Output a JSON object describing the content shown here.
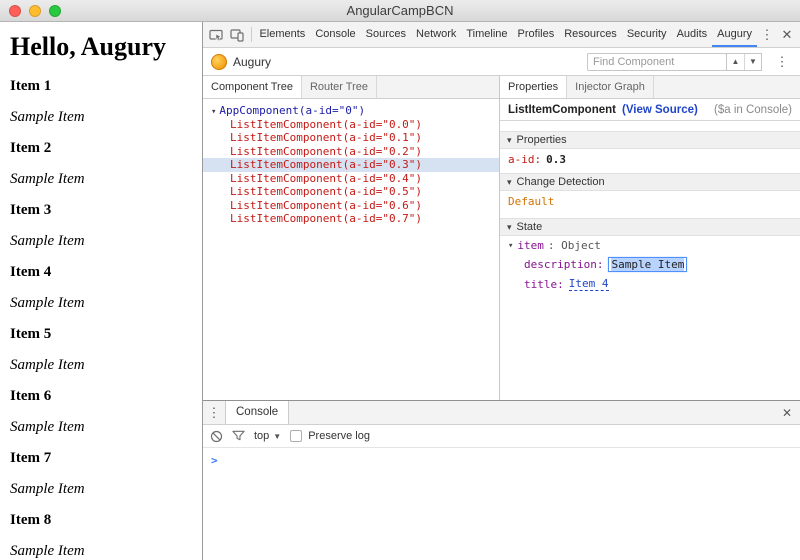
{
  "window": {
    "title": "AngularCampBCN"
  },
  "page": {
    "heading": "Hello, Augury",
    "items": [
      {
        "title": "Item 1",
        "description": "Sample Item"
      },
      {
        "title": "Item 2",
        "description": "Sample Item"
      },
      {
        "title": "Item 3",
        "description": "Sample Item"
      },
      {
        "title": "Item 4",
        "description": "Sample Item"
      },
      {
        "title": "Item 5",
        "description": "Sample Item"
      },
      {
        "title": "Item 6",
        "description": "Sample Item"
      },
      {
        "title": "Item 7",
        "description": "Sample Item"
      },
      {
        "title": "Item 8",
        "description": "Sample Item"
      }
    ]
  },
  "devtools": {
    "tabs": {
      "items": [
        "Elements",
        "Console",
        "Sources",
        "Network",
        "Timeline",
        "Profiles",
        "Resources",
        "Security",
        "Audits",
        "Augury"
      ],
      "selected": "Augury"
    },
    "augury": {
      "label": "Augury",
      "search_placeholder": "Find Component"
    },
    "tree_pane": {
      "tabs": [
        "Component Tree",
        "Router Tree"
      ],
      "selected_tab": "Component Tree",
      "root": "AppComponent(a-id=\"0\")",
      "children": [
        "ListItemComponent(a-id=\"0.0\")",
        "ListItemComponent(a-id=\"0.1\")",
        "ListItemComponent(a-id=\"0.2\")",
        "ListItemComponent(a-id=\"0.3\")",
        "ListItemComponent(a-id=\"0.4\")",
        "ListItemComponent(a-id=\"0.5\")",
        "ListItemComponent(a-id=\"0.6\")",
        "ListItemComponent(a-id=\"0.7\")"
      ],
      "selected_child": "ListItemComponent(a-id=\"0.3\")"
    },
    "props_pane": {
      "tabs": [
        "Properties",
        "Injector Graph"
      ],
      "selected_tab": "Properties",
      "component_name": "ListItemComponent",
      "view_source": "(View Source)",
      "console_hint": "($a in Console)",
      "properties_section": {
        "label": "Properties",
        "key": "a-id:",
        "value": "0.3"
      },
      "change_detection_section": {
        "label": "Change Detection",
        "value": "Default"
      },
      "state_section": {
        "label": "State",
        "object_key": "item",
        "object_rest": ": Object",
        "description_key": "description:",
        "description_value": "Sample Item",
        "title_key": "title:",
        "title_value": "Item 4"
      }
    },
    "console_drawer": {
      "tab": "Console",
      "context": "top",
      "preserve_log_label": "Preserve log",
      "prompt": ">"
    }
  },
  "icons": {
    "kebab": "⋮",
    "close": "✕",
    "caret_down": "▾",
    "arrow_up": "▲",
    "arrow_down": "▼"
  },
  "colors": {
    "accent": "#4285f4",
    "tree_root": "#1a1aa6",
    "tree_child": "#c41a16",
    "selected_row": "#d6e2f1",
    "key_purple": "#881391",
    "value_blue": "#2045c8",
    "orange": "#d57300",
    "traffic_red": "#ff5f57",
    "traffic_yellow": "#febc2e",
    "traffic_green": "#28c840"
  }
}
